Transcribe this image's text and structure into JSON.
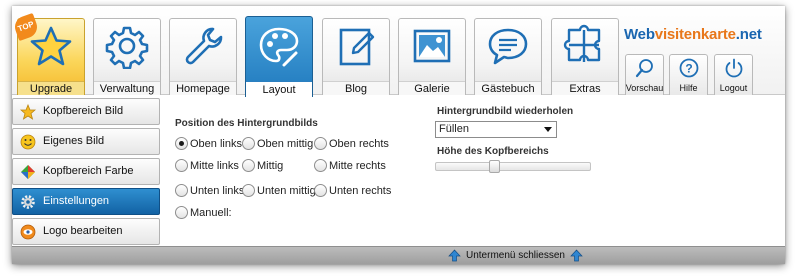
{
  "toolbar": {
    "tabs": [
      {
        "label": "Upgrade",
        "icon": "star-icon",
        "badge": "TOP"
      },
      {
        "label": "Verwaltung",
        "icon": "gear-icon"
      },
      {
        "label": "Homepage",
        "icon": "wrench-icon"
      },
      {
        "label": "Layout",
        "icon": "palette-icon",
        "active": true
      },
      {
        "label": "Blog",
        "icon": "edit-page-icon"
      },
      {
        "label": "Galerie",
        "icon": "picture-icon"
      },
      {
        "label": "Gästebuch",
        "icon": "speech-bubble-icon"
      },
      {
        "label": "Extras",
        "icon": "puzzle-icon"
      }
    ],
    "brand": {
      "part1": "Web",
      "part2": "visitenkarte",
      "part3": ".net"
    },
    "small_tabs": [
      {
        "label": "Vorschau",
        "icon": "magnifier-icon"
      },
      {
        "label": "Hilfe",
        "icon": "help-icon"
      },
      {
        "label": "Logout",
        "icon": "power-icon"
      }
    ]
  },
  "sidebar": {
    "items": [
      {
        "label": "Kopfbereich Bild",
        "icon": "star-small-icon"
      },
      {
        "label": "Eigenes Bild",
        "icon": "smiley-icon"
      },
      {
        "label": "Kopfbereich Farbe",
        "icon": "color-diamond-icon"
      },
      {
        "label": "Einstellungen",
        "icon": "settings-gear-icon",
        "active": true
      },
      {
        "label": "Logo bearbeiten",
        "icon": "logo-eye-icon"
      }
    ]
  },
  "content": {
    "position_title": "Position des Hintergrundbilds",
    "positions": [
      {
        "label": "Oben links",
        "checked": true
      },
      {
        "label": "Oben mittig",
        "checked": false
      },
      {
        "label": "Oben rechts",
        "checked": false
      },
      {
        "label": "Mitte links",
        "checked": false
      },
      {
        "label": "Mittig",
        "checked": false
      },
      {
        "label": "Mitte rechts",
        "checked": false
      },
      {
        "label": "Unten links",
        "checked": false
      },
      {
        "label": "Unten mittig",
        "checked": false
      },
      {
        "label": "Unten rechts",
        "checked": false
      },
      {
        "label": "Manuell:",
        "checked": false
      }
    ],
    "repeat_title": "Hintergrundbild wiederholen",
    "repeat_value": "Füllen",
    "height_title": "Höhe des Kopfbereichs",
    "height_slider_fraction": 0.37
  },
  "bottom": {
    "collapse_label": "Untermenü schliessen"
  },
  "colors": {
    "accent": "#1f79bd",
    "brand_blue": "#1a66b0",
    "brand_orange": "#e8771a",
    "upgrade_gold": "#f4b82a"
  }
}
